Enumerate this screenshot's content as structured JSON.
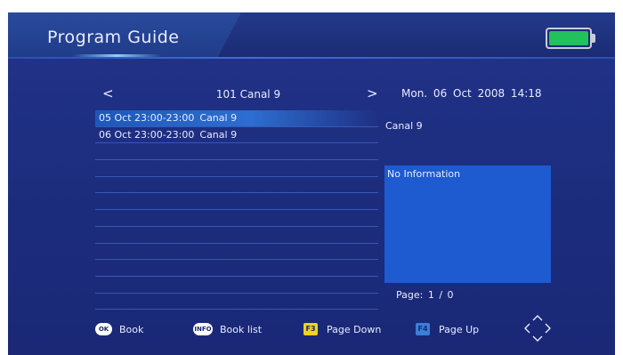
{
  "header": {
    "title": "Program Guide",
    "battery_color": "#22c15b"
  },
  "nav": {
    "prev_icon": "<",
    "next_icon": ">",
    "channel_title": "101 Canal 9",
    "datetime": "Mon.  06 Oct 2008 14:18"
  },
  "programs": [
    {
      "time": "05 Oct 23:00-23:00",
      "name": "Canal 9",
      "selected": true
    },
    {
      "time": "06 Oct 23:00-23:00",
      "name": "Canal 9",
      "selected": false
    },
    {
      "time": "",
      "name": ""
    },
    {
      "time": "",
      "name": ""
    },
    {
      "time": "",
      "name": ""
    },
    {
      "time": "",
      "name": ""
    },
    {
      "time": "",
      "name": ""
    },
    {
      "time": "",
      "name": ""
    },
    {
      "time": "",
      "name": ""
    },
    {
      "time": "",
      "name": ""
    },
    {
      "time": "",
      "name": ""
    },
    {
      "time": "",
      "name": ""
    }
  ],
  "info": {
    "channel": "Canal 9",
    "description": "No Information",
    "page": "Page:  1 /  0"
  },
  "footer": {
    "ok_key": "OK",
    "book_label": "Book",
    "info_key": "INFO",
    "book_list_label": "Book list",
    "f3_key": "F3",
    "page_down_label": "Page Down",
    "f4_key": "F4",
    "page_up_label": "Page Up"
  }
}
